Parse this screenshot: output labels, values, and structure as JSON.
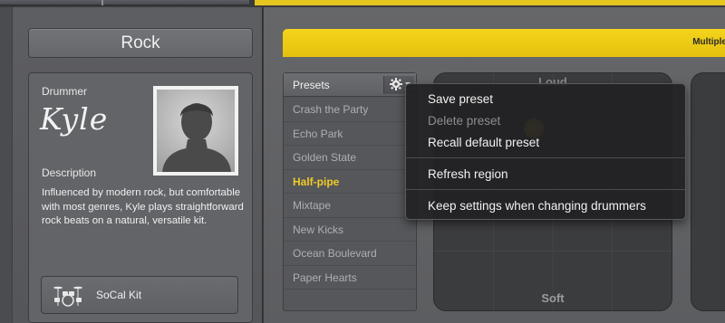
{
  "header": {
    "title": "Rock",
    "banner_text": "Multiple"
  },
  "drummer": {
    "label": "Drummer",
    "name": "Kyle",
    "description_label": "Description",
    "description": "Influenced by modern rock, but comfortable with most genres, Kyle plays straightforward rock beats on a natural, versatile kit."
  },
  "kit": {
    "label": "SoCal Kit"
  },
  "presets": {
    "title": "Presets",
    "items": [
      {
        "label": "Crash the Party"
      },
      {
        "label": "Echo Park"
      },
      {
        "label": "Golden State"
      },
      {
        "label": "Half-pipe"
      },
      {
        "label": "Mixtape"
      },
      {
        "label": "New Kicks"
      },
      {
        "label": "Ocean Boulevard"
      },
      {
        "label": "Paper Hearts"
      }
    ],
    "selected": "Half-pipe"
  },
  "xy_pad": {
    "top_label": "Loud",
    "bottom_label": "Soft"
  },
  "menu": {
    "save": "Save preset",
    "delete": "Delete preset",
    "recall": "Recall default preset",
    "refresh": "Refresh region",
    "keep": "Keep settings when changing drummers"
  },
  "colors": {
    "accent": "#e6c51f",
    "selected_text": "#efcb27"
  },
  "icons": {
    "gear": "gear-icon",
    "drum_kit": "drum-kit-icon",
    "avatar": "avatar"
  }
}
